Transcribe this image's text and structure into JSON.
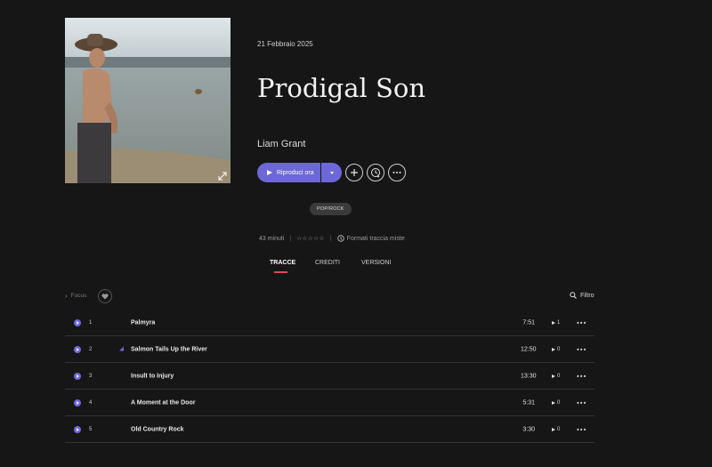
{
  "album": {
    "release_date": "21 Febbraio 2025",
    "title": "Prodigal Son",
    "artist": "Liam Grant",
    "genre": "POP/ROCK",
    "duration": "43 minuti",
    "rating_stars": "☆☆☆☆☆",
    "formats": "Formati traccia miste"
  },
  "actions": {
    "play_label": "Riproduci ora",
    "add_icon": "plus-icon",
    "download_icon": "clock-download-icon",
    "more_icon": "more-horizontal-icon"
  },
  "tabs": [
    {
      "label": "TRACCE",
      "active": true
    },
    {
      "label": "CREDITI",
      "active": false
    },
    {
      "label": "VERSIONI",
      "active": false
    }
  ],
  "toolbar": {
    "focus_label": "Focus",
    "filter_label": "Filtro"
  },
  "tracks": [
    {
      "number": "1",
      "title": "Palmyra",
      "duration": "7:51",
      "plays": "1",
      "hires": false
    },
    {
      "number": "2",
      "title": "Salmon Tails Up the River",
      "duration": "12:50",
      "plays": "0",
      "hires": true
    },
    {
      "number": "3",
      "title": "Insult to Injury",
      "duration": "13:30",
      "plays": "0",
      "hires": false
    },
    {
      "number": "4",
      "title": "A Moment at the Door",
      "duration": "5:31",
      "plays": "0",
      "hires": false
    },
    {
      "number": "5",
      "title": "Old Country Rock",
      "duration": "3:30",
      "plays": "0",
      "hires": false
    }
  ],
  "colors": {
    "background": "#161616",
    "accent": "#6d68d8",
    "tab_underline": "#e0484e"
  }
}
